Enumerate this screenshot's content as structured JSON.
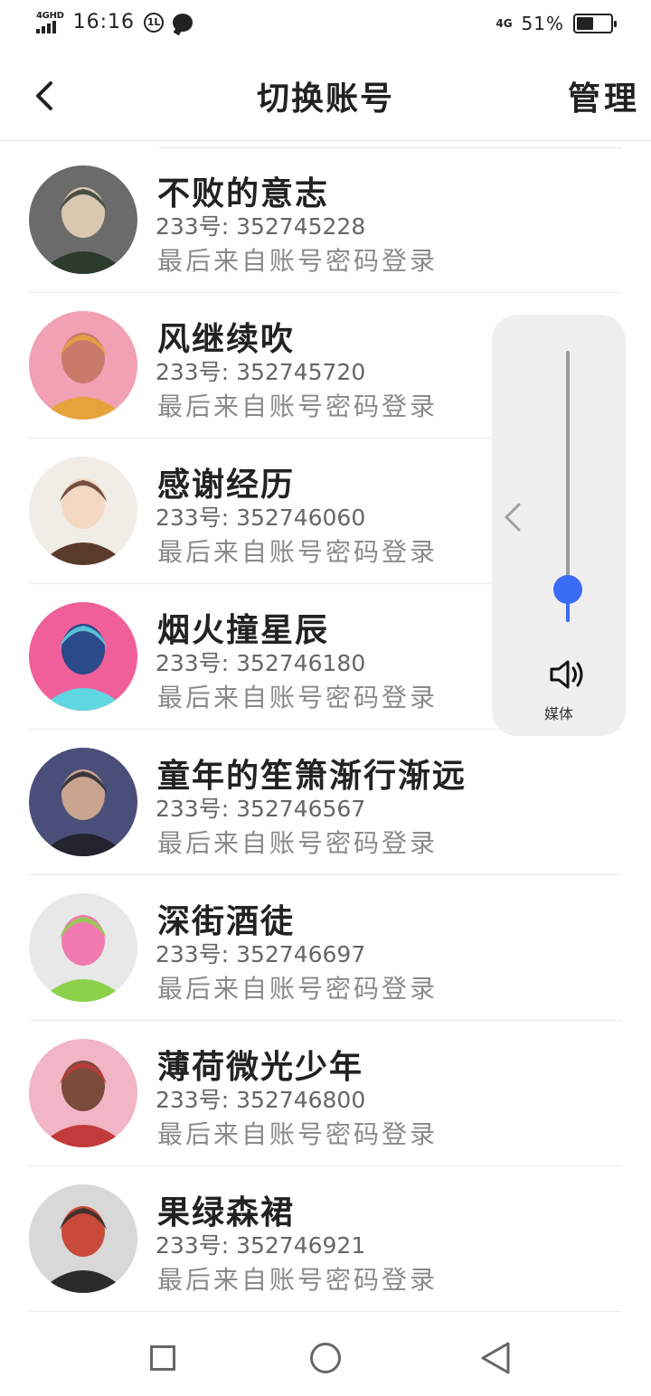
{
  "status_bar": {
    "network": "4GHD",
    "time": "16:16",
    "mode_badge": "1L",
    "net_right": "4G",
    "battery_percent": "51%",
    "battery_level": 0.51,
    "icons": [
      "signal-icon",
      "mode-badge-icon",
      "message-icon",
      "battery-icon"
    ]
  },
  "header": {
    "back_icon": "chevron-left-icon",
    "title": "切换账号",
    "manage_label": "管理"
  },
  "accounts": [
    {
      "name": "不败的意志",
      "id_text": "233号: 352745228",
      "last_login": "最后来自账号密码登录"
    },
    {
      "name": "风继续吹",
      "id_text": "233号: 352745720",
      "last_login": "最后来自账号密码登录"
    },
    {
      "name": "感谢经历",
      "id_text": "233号: 352746060",
      "last_login": "最后来自账号密码登录"
    },
    {
      "name": "烟火撞星辰",
      "id_text": "233号: 352746180",
      "last_login": "最后来自账号密码登录"
    },
    {
      "name": "童年的笙箫渐行渐远",
      "id_text": "233号: 352746567",
      "last_login": "最后来自账号密码登录"
    },
    {
      "name": "深街酒徒",
      "id_text": "233号: 352746697",
      "last_login": "最后来自账号密码登录"
    },
    {
      "name": "薄荷微光少年",
      "id_text": "233号: 352746800",
      "last_login": "最后来自账号密码登录"
    },
    {
      "name": "果绿森裙",
      "id_text": "233号: 352746921",
      "last_login": "最后来自账号密码登录"
    }
  ],
  "volume_panel": {
    "label": "媒体",
    "level": 0.12,
    "accent": "#3b6cf5",
    "icons": [
      "chevron-left-icon",
      "speaker-icon"
    ]
  },
  "nav_bar": {
    "icons": [
      "recents-square-icon",
      "home-circle-icon",
      "back-triangle-icon"
    ]
  }
}
